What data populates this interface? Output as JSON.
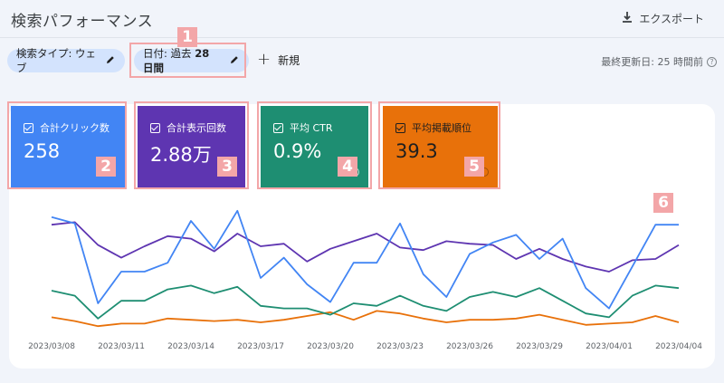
{
  "header": {
    "title": "検索パフォーマンス",
    "export_label": "エクスポート"
  },
  "filters": {
    "type_chip": "検索タイプ: ウェブ",
    "date_prefix": "日付: 過去 ",
    "date_bold": "28 日間",
    "new_label": "新規",
    "updated": "最終更新日: 25 時間前"
  },
  "metrics": [
    {
      "label": "合計クリック数",
      "value": "258",
      "color": "#4285f4"
    },
    {
      "label": "合計表示回数",
      "value": "2.88万",
      "color": "#5e35b1"
    },
    {
      "label": "平均 CTR",
      "value": "0.9%",
      "color": "#1e8e72"
    },
    {
      "label": "平均掲載順位",
      "value": "39.3",
      "color": "#e8710a"
    }
  ],
  "annotations": [
    "1",
    "2",
    "3",
    "4",
    "5",
    "6"
  ],
  "chart_data": {
    "type": "line",
    "x": [
      "2023/03/08",
      "2023/03/09",
      "2023/03/10",
      "2023/03/11",
      "2023/03/12",
      "2023/03/13",
      "2023/03/14",
      "2023/03/15",
      "2023/03/16",
      "2023/03/17",
      "2023/03/18",
      "2023/03/19",
      "2023/03/20",
      "2023/03/21",
      "2023/03/22",
      "2023/03/23",
      "2023/03/24",
      "2023/03/25",
      "2023/03/26",
      "2023/03/27",
      "2023/03/28",
      "2023/03/29",
      "2023/03/30",
      "2023/03/31",
      "2023/04/01",
      "2023/04/02",
      "2023/04/03",
      "2023/04/04"
    ],
    "tick_labels": [
      "2023/03/08",
      "2023/03/11",
      "2023/03/14",
      "2023/03/17",
      "2023/03/20",
      "2023/03/23",
      "2023/03/26",
      "2023/03/29",
      "2023/04/01",
      "2023/04/04"
    ],
    "series": [
      {
        "color": "#4285f4",
        "values": [
          0.93,
          0.88,
          0.25,
          0.5,
          0.5,
          0.57,
          0.9,
          0.68,
          0.98,
          0.45,
          0.61,
          0.4,
          0.26,
          0.57,
          0.57,
          0.88,
          0.48,
          0.3,
          0.64,
          0.73,
          0.79,
          0.6,
          0.76,
          0.37,
          0.21,
          0.54,
          0.87,
          0.87
        ]
      },
      {
        "color": "#5e35b1",
        "values": [
          0.87,
          0.89,
          0.71,
          0.61,
          0.7,
          0.78,
          0.76,
          0.66,
          0.8,
          0.7,
          0.72,
          0.58,
          0.68,
          0.74,
          0.8,
          0.69,
          0.67,
          0.74,
          0.72,
          0.71,
          0.6,
          0.68,
          0.6,
          0.54,
          0.5,
          0.59,
          0.6,
          0.71
        ]
      },
      {
        "color": "#1e8e72",
        "values": [
          0.35,
          0.31,
          0.13,
          0.27,
          0.27,
          0.36,
          0.39,
          0.33,
          0.38,
          0.23,
          0.21,
          0.21,
          0.16,
          0.25,
          0.23,
          0.31,
          0.23,
          0.19,
          0.3,
          0.34,
          0.3,
          0.37,
          0.27,
          0.17,
          0.14,
          0.31,
          0.39,
          0.37
        ]
      },
      {
        "color": "#e8710a",
        "values": [
          0.14,
          0.11,
          0.07,
          0.09,
          0.09,
          0.13,
          0.12,
          0.11,
          0.12,
          0.1,
          0.12,
          0.15,
          0.18,
          0.12,
          0.19,
          0.17,
          0.13,
          0.1,
          0.12,
          0.12,
          0.13,
          0.16,
          0.12,
          0.08,
          0.09,
          0.1,
          0.15,
          0.1
        ]
      }
    ]
  }
}
